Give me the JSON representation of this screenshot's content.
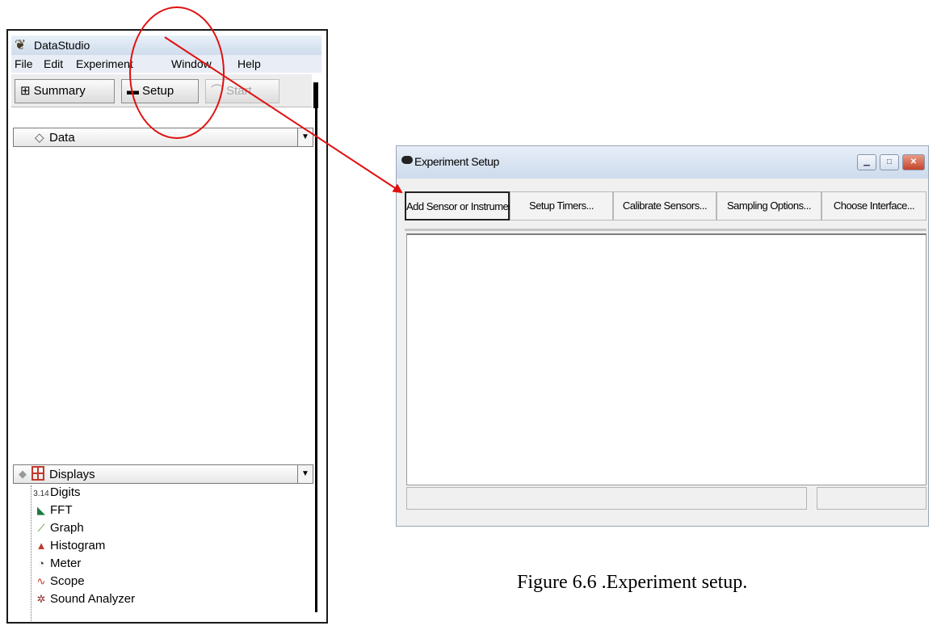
{
  "datastudio": {
    "title": "DataStudio",
    "app_icon": "datastudio-icon",
    "menu": [
      "File",
      "Edit",
      "Experiment",
      "Window",
      "Help"
    ],
    "toolbar": {
      "summary_label": "Summary",
      "setup_label": "Setup",
      "start_label": "Start"
    },
    "data_combo_label": "Data",
    "displays_combo_label": "Displays",
    "displays": [
      {
        "label": "Digits",
        "icon": "digits-icon",
        "glyph": "3.14"
      },
      {
        "label": "FFT",
        "icon": "fft-icon",
        "glyph": "◣"
      },
      {
        "label": "Graph",
        "icon": "graph-icon",
        "glyph": "⟋"
      },
      {
        "label": "Histogram",
        "icon": "histogram-icon",
        "glyph": "▲"
      },
      {
        "label": "Meter",
        "icon": "meter-icon",
        "glyph": "◔"
      },
      {
        "label": "Scope",
        "icon": "scope-icon",
        "glyph": "∿"
      },
      {
        "label": "Sound Analyzer",
        "icon": "sound-analyzer-icon",
        "glyph": "✲"
      }
    ]
  },
  "experiment_setup": {
    "title": "Experiment Setup",
    "buttons": [
      "Add Sensor or Instrument...",
      "Setup Timers...",
      "Calibrate Sensors...",
      "Sampling Options...",
      "Choose Interface..."
    ],
    "active_button_index": 0
  },
  "annotation_color": "#e01010",
  "caption": "Figure 6.6 .Experiment setup."
}
